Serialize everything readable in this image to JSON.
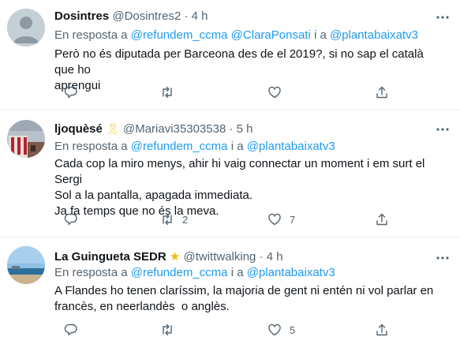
{
  "tweets": [
    {
      "name": "Dosintres",
      "handle": "@Dosintres2",
      "dot": "·",
      "time": "4 h",
      "reply_prefix": "En resposta a",
      "reply_links": "@refundem_ccma @ClaraPonsati",
      "reply_and": "i a",
      "reply_last": "@plantabaixatv3",
      "text": "Però no és diputada per Barceona des de el 2019?, si no sap el català que ho\naprengui",
      "counts": {
        "reply": "",
        "retweet": "",
        "like": ""
      }
    },
    {
      "name": "ljoquèsé",
      "badge": "🎗",
      "handle": "@Mariavi35303538",
      "dot": "·",
      "time": "5 h",
      "reply_prefix": "En resposta a",
      "reply_links": "@refundem_ccma",
      "reply_and": "i a",
      "reply_last": "@plantabaixatv3",
      "text": "Cada cop la miro menys, ahir hi vaig connectar un moment i em surt el Sergi\nSol a la pantalla, apagada immediata.\nJa fa temps que no és la meva.",
      "counts": {
        "reply": "",
        "retweet": "2",
        "like": "7"
      }
    },
    {
      "name": "La Guingueta SEDR",
      "badge": "★",
      "handle": "@twittwalking",
      "dot": "·",
      "time": "4 h",
      "reply_prefix": "En resposta a",
      "reply_links": "@refundem_ccma",
      "reply_and": "i a",
      "reply_last": "@plantabaixatv3",
      "text": "A Flandes ho tenen claríssim, la majoria de gent ni entén ni vol parlar en\nfrancès, en neerlandès  o anglès.",
      "counts": {
        "reply": "",
        "retweet": "",
        "like": "5"
      }
    }
  ],
  "colors": {
    "link": "#1d9bf0",
    "muted": "#536471",
    "divider": "#eff3f4",
    "star": "#f5b800",
    "ribbon": "#f7c92d"
  },
  "icons": [
    "more-icon",
    "reply-icon",
    "retweet-icon",
    "like-icon",
    "share-icon"
  ]
}
